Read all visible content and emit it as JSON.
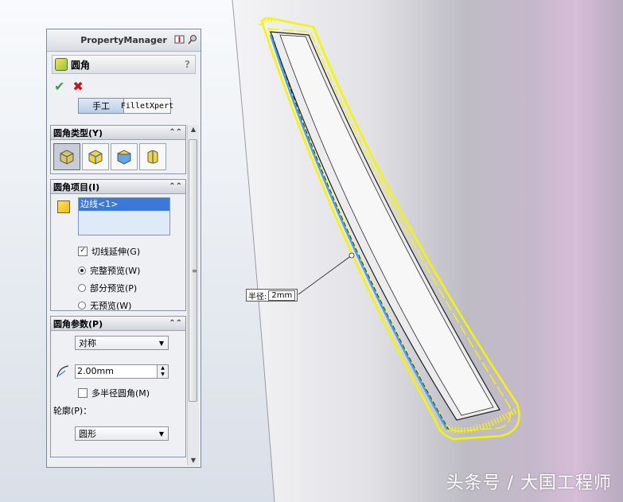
{
  "panel": {
    "header": "PropertyManager",
    "feature_title": "圆角",
    "help": "?",
    "ok_symbol": "✔",
    "cancel_symbol": "✖",
    "tabs": {
      "manual": "手工",
      "xpert": "FilletXpert"
    }
  },
  "groups": {
    "type": {
      "label": "圆角类型(Y)",
      "collapse": "⌃⌃"
    },
    "items": {
      "label": "圆角项目(I)",
      "collapse": "⌃⌃",
      "edge_selected": "边线<1>",
      "tangent_label": "切线延伸(G)",
      "preview_full": "完整预览(W)",
      "preview_partial": "部分预览(P)",
      "preview_none": "无预览(W)"
    },
    "params": {
      "label": "圆角参数(P)",
      "collapse": "⌃⌃",
      "method": "对称",
      "radius_value": "2.00mm",
      "multi_radius_label": "多半径圆角(M)",
      "profile_label": "轮廓(P)：",
      "profile_value": "圆形"
    }
  },
  "viewport": {
    "callout_label": "半径:",
    "callout_value": "2mm",
    "highlight_color": "#f5f500",
    "edge_color": "#4aa0e8"
  },
  "watermark": "头条号 / 大国工程师"
}
